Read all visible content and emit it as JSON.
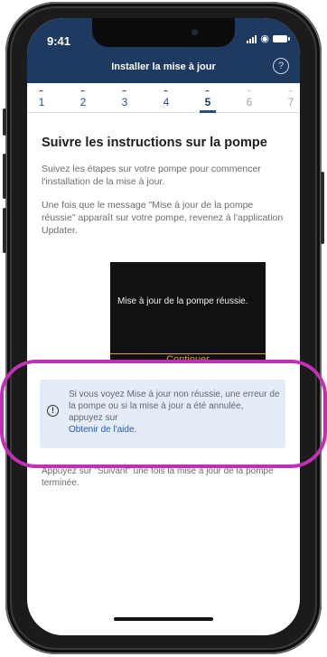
{
  "status_bar": {
    "time": "9:41"
  },
  "nav": {
    "title": "Installer la mise à jour",
    "help": "?"
  },
  "steps": [
    "1",
    "2",
    "3",
    "4",
    "5",
    "6",
    "7"
  ],
  "active_step": 5,
  "content": {
    "heading": "Suivre les instructions sur la pompe",
    "para1": "Suivez les étapes sur votre pompe pour commencer l'installation de la mise à jour.",
    "para2": "Une fois que le message \"Mise à jour de la pompe réussie\" apparaît sur votre pompe, revenez à l'application Updater."
  },
  "pump_screen": {
    "message": "Mise à jour de la pompe réussie.",
    "button": "Continuer"
  },
  "alert": {
    "icon": "info-icon",
    "text": "Si vous voyez Mise à jour non réussie, une erreur de la pompe ou si la mise à jour a été annulée, appuyez sur",
    "link": "Obtenir de l'aide."
  },
  "footer_text": "Appuyez sur \"Suivant\" une fois la mise à jour de la pompe terminée.",
  "colors": {
    "header_bg": "#1f3a60",
    "alert_bg": "#e4ecf7",
    "link": "#2a5aa8",
    "highlight": "#c02fb6",
    "pump_accent": "#e0a21d"
  }
}
